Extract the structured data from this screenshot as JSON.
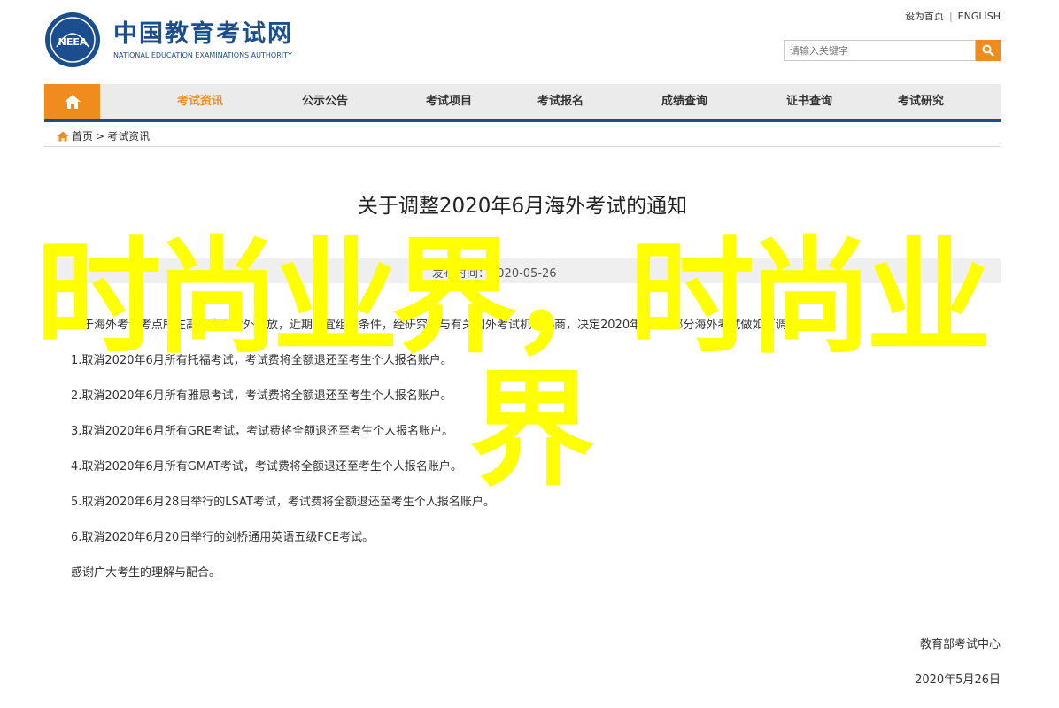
{
  "header": {
    "set_home": "设为首页",
    "english": "ENGLISH",
    "logo_cn": "中国教育考试网",
    "logo_en": "NATIONAL EDUCATION EXAMINATIONS AUTHORITY",
    "emblem_text": "NEEA"
  },
  "search": {
    "placeholder": "请输入关键字"
  },
  "nav": {
    "items": [
      {
        "label": "考试资讯",
        "active": true
      },
      {
        "label": "公示公告"
      },
      {
        "label": "考试项目"
      },
      {
        "label": "考试报名"
      },
      {
        "label": "成绩查询"
      },
      {
        "label": "证书查询"
      },
      {
        "label": "考试研究"
      }
    ]
  },
  "breadcrumb": {
    "home": "首页",
    "sep": ">",
    "current": "考试资讯"
  },
  "article": {
    "title": "关于调整2020年6月海外考试的通知",
    "date": "发布时间：2020-05-26",
    "intro": "鉴于海外考试考点所在高校尚未对外开放，近期不宜组考条件，经研究并与有关国外考试机构协商，决定2020年6月份部分海外考试做如下调整：",
    "items": [
      "1.取消2020年6月所有托福考试，考试费将全额退还至考生个人报名账户。",
      "2.取消2020年6月所有雅思考试，考试费将全额退还至考生个人报名账户。",
      "3.取消2020年6月所有GRE考试，考试费将全额退还至考生个人报名账户。",
      "4.取消2020年6月所有GMAT考试，考试费将全额退还至考生个人报名账户。",
      "5.取消2020年6月28日举行的LSAT考试，考试费将全额退还至考生个人报名账户。",
      "6.取消2020年6月20日举行的剑桥通用英语五级FCE考试。"
    ],
    "thanks": "感谢广大考生的理解与配合。",
    "signature": "教育部考试中心",
    "sign_date": "2020年5月26日"
  },
  "watermark": {
    "line1": "时尚业界，时尚业",
    "line2": "界"
  },
  "colors": {
    "brand_blue": "#1b4e8e",
    "accent_orange": "#f08c1e",
    "watermark_yellow": "#ffff00"
  }
}
